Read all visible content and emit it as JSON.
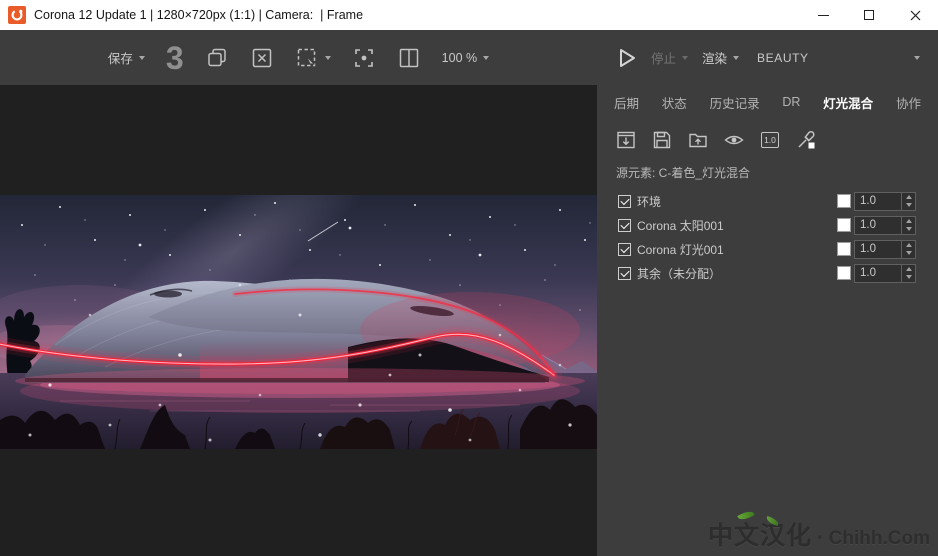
{
  "title_bar": {
    "app_icon": "corona-logo",
    "title": "Corona 12 Update 1 | 1280×720px (1:1) | Camera:  | Frame"
  },
  "toolbar": {
    "save_label": "保存",
    "pass_count": "3",
    "zoom_value": "100 %",
    "icons": [
      "duplicate-icon",
      "clear-image-icon",
      "region-select-icon",
      "focus-point-icon",
      "ab-compare-icon"
    ]
  },
  "render_controls": {
    "play_icon": "play-icon",
    "stop_label": "停止",
    "render_label": "渲染",
    "channel": "BEAUTY"
  },
  "tabs": [
    {
      "label": "后期",
      "active": false
    },
    {
      "label": "状态",
      "active": false
    },
    {
      "label": "历史记录",
      "active": false
    },
    {
      "label": "DR",
      "active": false
    },
    {
      "label": "灯光混合",
      "active": true
    },
    {
      "label": "协作",
      "active": false
    }
  ],
  "lightmix": {
    "tool_icons": [
      "import-icon",
      "save-icon",
      "load-icon",
      "eye-icon",
      "reset-values-icon",
      "color-picker-icon"
    ],
    "reset_icon_label": "1.0",
    "source_label": "源元素: C-着色_灯光混合",
    "rows": [
      {
        "label": "环境",
        "checked": true,
        "value": "1.0",
        "swatch_color": "#ffffff"
      },
      {
        "label": "Corona 太阳001",
        "checked": true,
        "value": "1.0",
        "swatch_color": "#ffffff"
      },
      {
        "label": "Corona 灯光001",
        "checked": true,
        "value": "1.0",
        "swatch_color": "#ffffff"
      },
      {
        "label": "其余（未分配）",
        "checked": true,
        "value": "1.0",
        "swatch_color": "#ffffff"
      }
    ]
  },
  "watermark": {
    "cn": "中文汉化",
    "sep": "·",
    "en": "Chihh.Com"
  },
  "colors": {
    "titlebar_bg": "#ffffff",
    "panel_bg": "#3d3d3d",
    "canvas_bg": "#202020",
    "accent_orange": "#ea5b2a",
    "neon_red": "#ff2038",
    "text_light": "#c9c9c9",
    "tab_active_text": "#ffffff"
  }
}
